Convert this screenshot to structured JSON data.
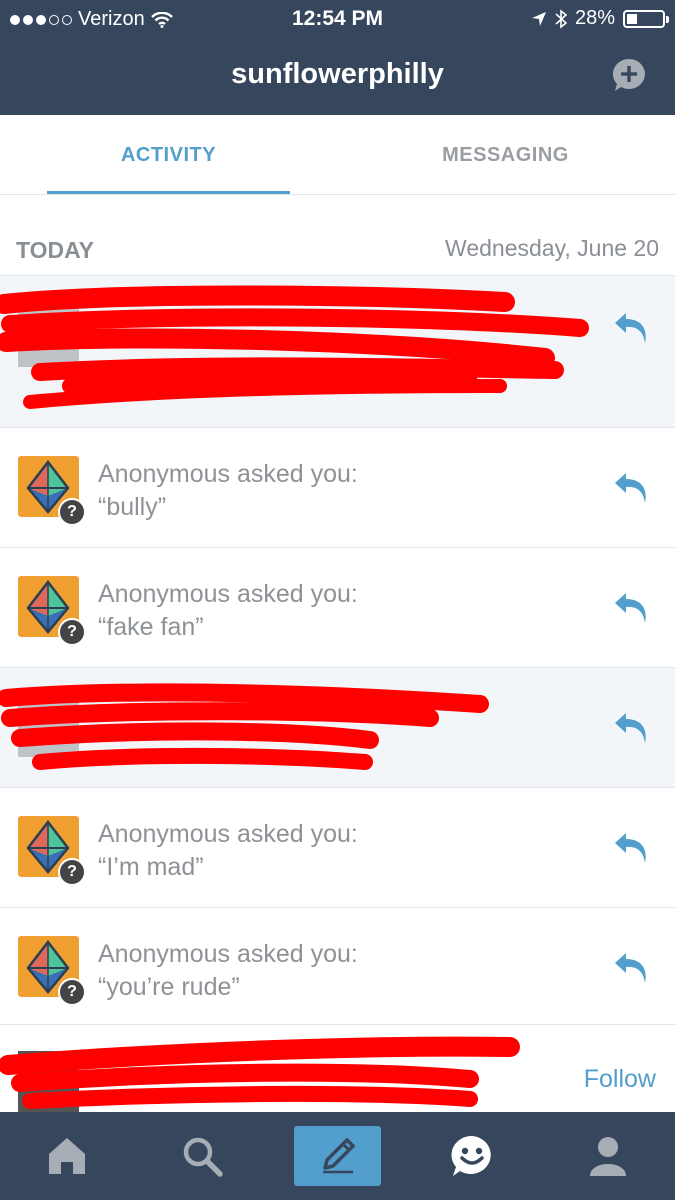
{
  "status_bar": {
    "carrier": "Verizon",
    "time": "12:54 PM",
    "battery": "28%",
    "battery_level": 0.28,
    "signal_bars": 3,
    "signal_total": 5
  },
  "header": {
    "title": "sunflowerphilly",
    "compose_icon": "plus-bubble-icon"
  },
  "tabs": [
    {
      "label": "ACTIVITY",
      "active": true
    },
    {
      "label": "MESSAGING",
      "active": false
    }
  ],
  "section": {
    "label": "TODAY",
    "date": "Wednesday, June 20"
  },
  "items": [
    {
      "type": "redacted"
    },
    {
      "type": "ask",
      "line1": "Anonymous asked you:",
      "line2": "“bully”"
    },
    {
      "type": "ask",
      "line1": "Anonymous asked you:",
      "line2": "“fake fan”"
    },
    {
      "type": "redacted"
    },
    {
      "type": "ask",
      "line1": "Anonymous asked you:",
      "line2": "“I’m mad”"
    },
    {
      "type": "ask",
      "line1": "Anonymous asked you:",
      "line2": "“you’re rude”"
    }
  ],
  "follow_row": {
    "button": "Follow"
  },
  "bottom_nav": {
    "items": [
      "home-icon",
      "search-icon",
      "compose-pencil-icon",
      "activity-smiley-icon",
      "account-icon"
    ]
  },
  "colors": {
    "nav_bg": "#36465d",
    "accent": "#529ecc",
    "redaction": "#ff0000",
    "anon_avatar": "#f0a030"
  }
}
